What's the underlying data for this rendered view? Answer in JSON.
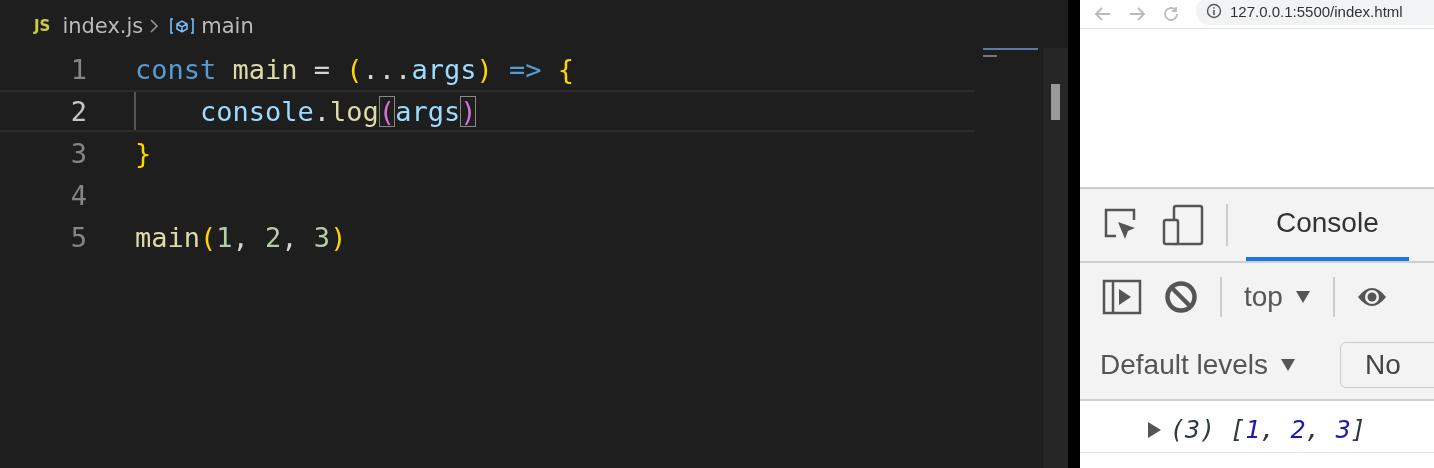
{
  "editor": {
    "breadcrumb": {
      "file_icon": "JS",
      "file": "index.js",
      "symbol": "main"
    },
    "lines": [
      {
        "number": "1",
        "active": false,
        "tokens": [
          {
            "text": "const",
            "kind": "keyword"
          },
          {
            "text": " main",
            "kind": "func"
          },
          {
            "text": " = ",
            "kind": "plain"
          },
          {
            "text": "(",
            "kind": "paren"
          },
          {
            "text": "...",
            "kind": "plain"
          },
          {
            "text": "args",
            "kind": "param"
          },
          {
            "text": ")",
            "kind": "paren"
          },
          {
            "text": " =>",
            "kind": "keyword"
          },
          {
            "text": " {",
            "kind": "paren"
          }
        ]
      },
      {
        "number": "2",
        "active": true,
        "tokens": [
          {
            "text": "    console",
            "kind": "param"
          },
          {
            "text": ".",
            "kind": "plain"
          },
          {
            "text": "log",
            "kind": "func"
          },
          {
            "text": "(",
            "kind": "paren2",
            "matched": true
          },
          {
            "text": "args",
            "kind": "param"
          },
          {
            "text": ")",
            "kind": "paren2",
            "matched": true
          }
        ]
      },
      {
        "number": "3",
        "active": false,
        "tokens": [
          {
            "text": "}",
            "kind": "paren"
          }
        ]
      },
      {
        "number": "4",
        "active": false
      },
      {
        "number": "5",
        "active": false,
        "tokens": [
          {
            "text": "main",
            "kind": "func"
          },
          {
            "text": "(",
            "kind": "paren"
          },
          {
            "text": "1",
            "kind": "number"
          },
          {
            "text": ", ",
            "kind": "plain"
          },
          {
            "text": "2",
            "kind": "number"
          },
          {
            "text": ", ",
            "kind": "plain"
          },
          {
            "text": "3",
            "kind": "number"
          },
          {
            "text": ")",
            "kind": "paren"
          }
        ]
      }
    ]
  },
  "browser": {
    "address": "127.0.0.1:5500/index.html",
    "devtools": {
      "tabs": [
        {
          "label": "Console",
          "selected": true
        }
      ],
      "context": "top",
      "levels": "Default levels",
      "filter_placeholder": "No",
      "output": [
        {
          "expanded": false,
          "tokens": [
            {
              "text": "(3) ",
              "kind": "plain"
            },
            {
              "text": "[",
              "kind": "plain"
            },
            {
              "text": "1",
              "kind": "number"
            },
            {
              "text": ", ",
              "kind": "plain"
            },
            {
              "text": "2",
              "kind": "number"
            },
            {
              "text": ", ",
              "kind": "plain"
            },
            {
              "text": "3",
              "kind": "number"
            },
            {
              "text": "]",
              "kind": "plain"
            }
          ]
        }
      ]
    }
  }
}
